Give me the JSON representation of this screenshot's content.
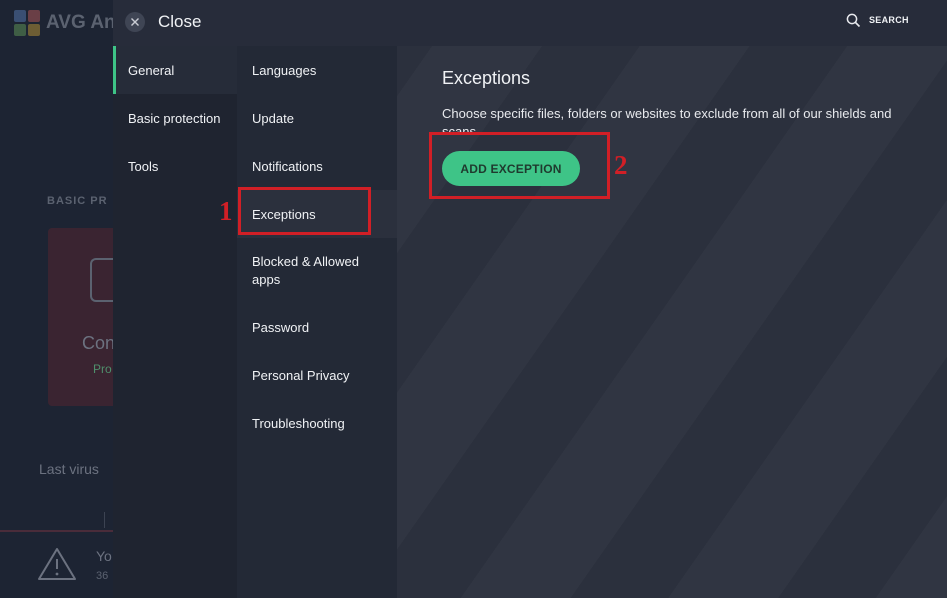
{
  "background": {
    "app_name_fragment": "AVG An",
    "section_label_fragment": "BASIC PR",
    "card_title_fragment": "Con",
    "card_subtitle_fragment": "Pro",
    "last_scan_fragment": "Last virus",
    "warning_title_fragment": "Yo",
    "warning_subtitle_fragment": "36",
    "logo_colors": [
      "#4f81c7",
      "#e0463e",
      "#58b947",
      "#f5b622"
    ]
  },
  "header": {
    "close_label": "Close",
    "search_label": "SEARCH"
  },
  "primary_nav": [
    {
      "label": "General",
      "active": true
    },
    {
      "label": "Basic protection",
      "active": false
    },
    {
      "label": "Tools",
      "active": false
    }
  ],
  "secondary_nav": [
    {
      "label": "Languages",
      "active": false
    },
    {
      "label": "Update",
      "active": false
    },
    {
      "label": "Notifications",
      "active": false
    },
    {
      "label": "Exceptions",
      "active": true
    },
    {
      "label": "Blocked & Allowed apps",
      "active": false
    },
    {
      "label": "Password",
      "active": false
    },
    {
      "label": "Personal Privacy",
      "active": false
    },
    {
      "label": "Troubleshooting",
      "active": false
    }
  ],
  "content": {
    "title": "Exceptions",
    "description": "Choose specific files, folders or websites to exclude from all of our shields and scans.",
    "add_button_label": "ADD EXCEPTION"
  },
  "annotations": {
    "step1": "1",
    "step2": "2",
    "color": "#d11f26"
  },
  "colors": {
    "accent": "#3ec487"
  }
}
